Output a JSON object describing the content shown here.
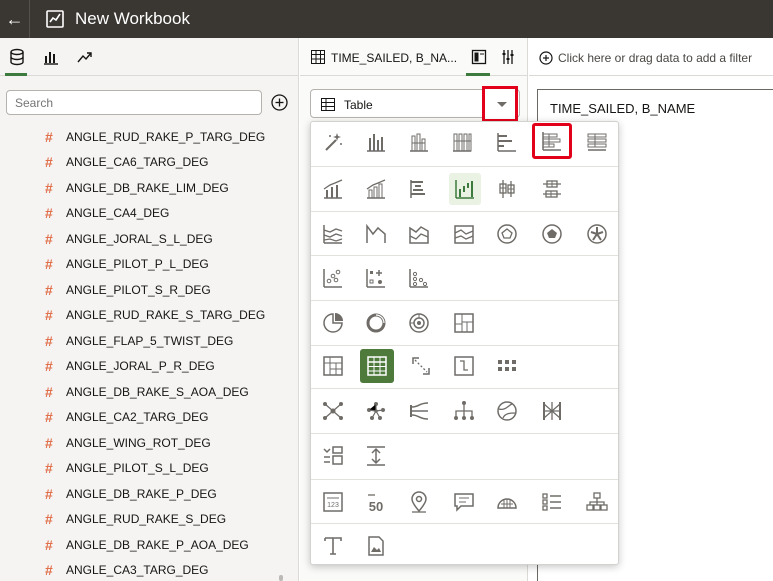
{
  "app": {
    "title": "New Workbook"
  },
  "left_panel": {
    "search_placeholder": "Search",
    "fields": [
      "ANGLE_RUD_RAKE_P_TARG_DEG",
      "ANGLE_CA6_TARG_DEG",
      "ANGLE_DB_RAKE_LIM_DEG",
      "ANGLE_CA4_DEG",
      "ANGLE_JORAL_S_L_DEG",
      "ANGLE_PILOT_P_L_DEG",
      "ANGLE_PILOT_S_R_DEG",
      "ANGLE_RUD_RAKE_S_TARG_DEG",
      "ANGLE_FLAP_5_TWIST_DEG",
      "ANGLE_JORAL_P_R_DEG",
      "ANGLE_DB_RAKE_S_AOA_DEG",
      "ANGLE_CA2_TARG_DEG",
      "ANGLE_WING_ROT_DEG",
      "ANGLE_PILOT_S_L_DEG",
      "ANGLE_DB_RAKE_P_DEG",
      "ANGLE_RUD_RAKE_S_DEG",
      "ANGLE_DB_RAKE_P_AOA_DEG",
      "ANGLE_CA3_TARG_DEG"
    ]
  },
  "middle_panel": {
    "header_title": "TIME_SAILED, B_NA...",
    "viz_type": "Table"
  },
  "right_panel": {
    "filter_hint": "Click here or drag data to add a filter",
    "canvas_title": "TIME_SAILED, B_NAME"
  },
  "colors": {
    "topbar": "#3a3632",
    "accent_green": "#3c7a3d",
    "highlight_red": "#e2001a",
    "measure_hash": "#e16f4b"
  }
}
